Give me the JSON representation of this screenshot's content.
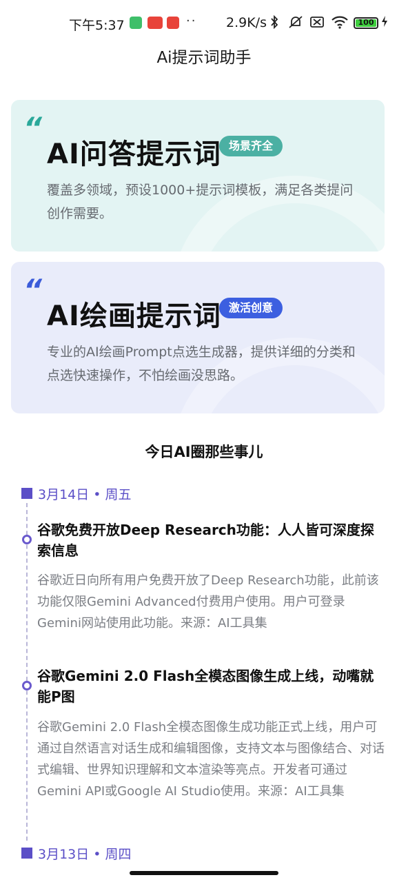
{
  "status_bar": {
    "time": "下午5:37",
    "dots": "··",
    "speed": "2.9K/s",
    "bluetooth_icon": "bluetooth-icon",
    "mute_icon": "bell-off-icon",
    "sim_icon": "no-sim-icon",
    "wifi_icon": "wifi-icon",
    "battery": "100",
    "charging_icon": "bolt-icon"
  },
  "header": {
    "title": "Ai提示词助手"
  },
  "cards": [
    {
      "quote": "“",
      "title": "AI问答提示词",
      "badge": "场景齐全",
      "description": "覆盖多领域，预设1000+提示词模板，满足各类提问创作需要。",
      "accent": "#4bb0a3"
    },
    {
      "quote": "“",
      "title": "AI绘画提示词",
      "badge": "激活创意",
      "description": "专业的AI绘画Prompt点选生成器，提供详细的分类和点选快速操作，不怕绘画没思路。",
      "accent": "#3c5fe0"
    }
  ],
  "news": {
    "section_title": "今日AI圈那些事儿",
    "groups": [
      {
        "date": "3月14日 • 周五",
        "items": [
          {
            "title": "谷歌免费开放Deep Research功能：人人皆可深度探索信息",
            "body": "谷歌近日向所有用户免费开放了Deep Research功能，此前该功能仅限Gemini Advanced付费用户使用。用户可登录Gemini网站使用此功能。来源：AI工具集"
          },
          {
            "title": "谷歌Gemini 2.0 Flash全模态图像生成上线，动嘴就能P图",
            "body": "谷歌Gemini 2.0 Flash全模态图像生成功能正式上线，用户可通过自然语言对话生成和编辑图像，支持文本与图像结合、对话式编辑、世界知识理解和文本渲染等亮点。开发者可通过Gemini API或Google AI Studio使用。来源：AI工具集"
          }
        ]
      },
      {
        "date": "3月13日 • 周四",
        "items": []
      }
    ]
  },
  "colors": {
    "timeline_accent": "#5b4fc7",
    "qa_card_bg": "#e3f4f3",
    "draw_card_bg": "#e9ecfa"
  }
}
